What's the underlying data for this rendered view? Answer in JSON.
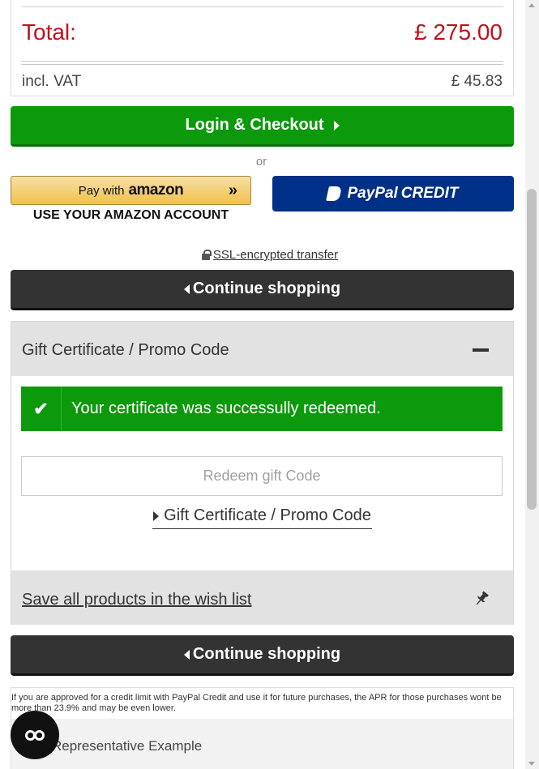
{
  "summary": {
    "total_label": "Total:",
    "total_value": "£ 275.00",
    "vat_label": "incl. VAT",
    "vat_value": "£ 45.83"
  },
  "checkout": {
    "login_checkout_label": "Login & Checkout",
    "or_text": "or",
    "amazon": {
      "pay_with": "Pay with",
      "brand": "amazon",
      "chevrons": "»",
      "caption": "USE YOUR AMAZON ACCOUNT"
    },
    "paypal": {
      "brand": "PayPal",
      "product": "CREDIT"
    },
    "ssl_text": "SSL-encrypted transfer"
  },
  "continue_shopping_label": "Continue shopping",
  "gift": {
    "header_title": "Gift Certificate / Promo Code",
    "success_message": "Your certificate was successully redeemed.",
    "redeem_placeholder": "Redeem gift Code",
    "redeem_link_label": "Gift Certificate / Promo Code"
  },
  "wishlist": {
    "save_all_label": "Save all products in the wish list"
  },
  "footnote": {
    "apr_text": "If you are approved for a credit limit with PayPal Credit and use it for future purchases, the APR for those purchases wont be more than 23.9% and may be even lower.",
    "representative_label": "Representative Example"
  },
  "colors": {
    "total_red": "#c0101c",
    "green": "#0c9a0c",
    "dark": "#333333",
    "paypal_blue": "#003087",
    "amazon_gold": "#f0c14b"
  },
  "icons": {
    "caret_right": "caret-right-icon",
    "caret_left": "caret-left-icon",
    "lock": "lock-icon",
    "minus": "minus-icon",
    "check": "check-icon",
    "pin": "pin-icon",
    "chat": "chat-icon"
  }
}
